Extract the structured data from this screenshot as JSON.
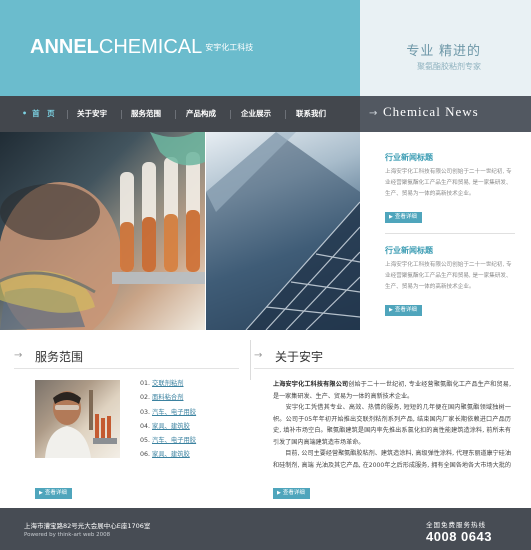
{
  "header": {
    "logo_bold": "ANNEL",
    "logo_light": "CHEMICAL",
    "logo_cn": "安宇化工科技",
    "slogan_main": "专业  精进的",
    "slogan_sub": "聚氨酯胶粘剂专家"
  },
  "nav": {
    "items": [
      {
        "label": "首　页",
        "active": true
      },
      {
        "label": "关于安宇"
      },
      {
        "label": "服务范围"
      },
      {
        "label": "产品构成"
      },
      {
        "label": "企业展示"
      },
      {
        "label": "联系我们"
      }
    ]
  },
  "news": {
    "header_title": "Chemical News",
    "items": [
      {
        "title": "行业新闻标题",
        "body": "上海安宇化工科技有限公司创始于二十一世纪初, 专业经营聚氨酯化工产品生产和贸易, 是一家集研发、生产、贸易为一体的高新技术企业。",
        "more": "查看详细"
      },
      {
        "title": "行业新闻标题",
        "body": "上海安宇化工科技有限公司创始于二十一世纪初, 专业经营聚氨酯化工产品生产和贸易, 是一家集研发、生产、贸易为一体的高新技术企业。",
        "more": "查看详细"
      }
    ]
  },
  "services": {
    "title": "服务范围",
    "items": [
      {
        "num": "01.",
        "label": "交联剂粘剂"
      },
      {
        "num": "02.",
        "label": "面料粘合剂"
      },
      {
        "num": "03.",
        "label": "汽车、电子用胶"
      },
      {
        "num": "04.",
        "label": "家具、建筑胶"
      },
      {
        "num": "05.",
        "label": "汽车、电子用胶"
      },
      {
        "num": "06.",
        "label": "家具、建筑胶"
      }
    ],
    "more": "查看详细"
  },
  "about": {
    "title": "关于安宇",
    "company": "上海安宇化工科技有限公司",
    "p1": "创始于二十一世纪初, 专业经营聚氨酯化工产品生产和贸易, 是一家集研发、生产、贸易为一体的高新技术企业。",
    "p2": "　　安宇化工凭借其专业、高效、热情的服务, 短短的几年便在国内聚氨酯领域独树一帜。公司于05年年初开始推出交联剂粘剂系列产品, 结束国内厂家长期依赖进口产品历史, 填补市场空白。聚氨酯建筑是国内率先推出系氯化扣的高性能建筑造涂料, 前所未有引发了国内高端建筑造市场革命。",
    "p3": "　　目前, 公司主要经营聚氨酯胶粘剂、建筑造涂料, 高级弹性涂料, 代理东丽道康宁硅油和硅制剂, 高端 光油及其它产品, 在2000年之后形成服务, 拥有全国各地各大市场大批的客户。",
    "more": "查看详细"
  },
  "footer": {
    "address": "上海市漕宝路82号光大会展中心E座1706室",
    "powered": "Powered by think-art web 2008",
    "hotline_label": "全国免费服务热线",
    "hotline": "4008 0643"
  }
}
